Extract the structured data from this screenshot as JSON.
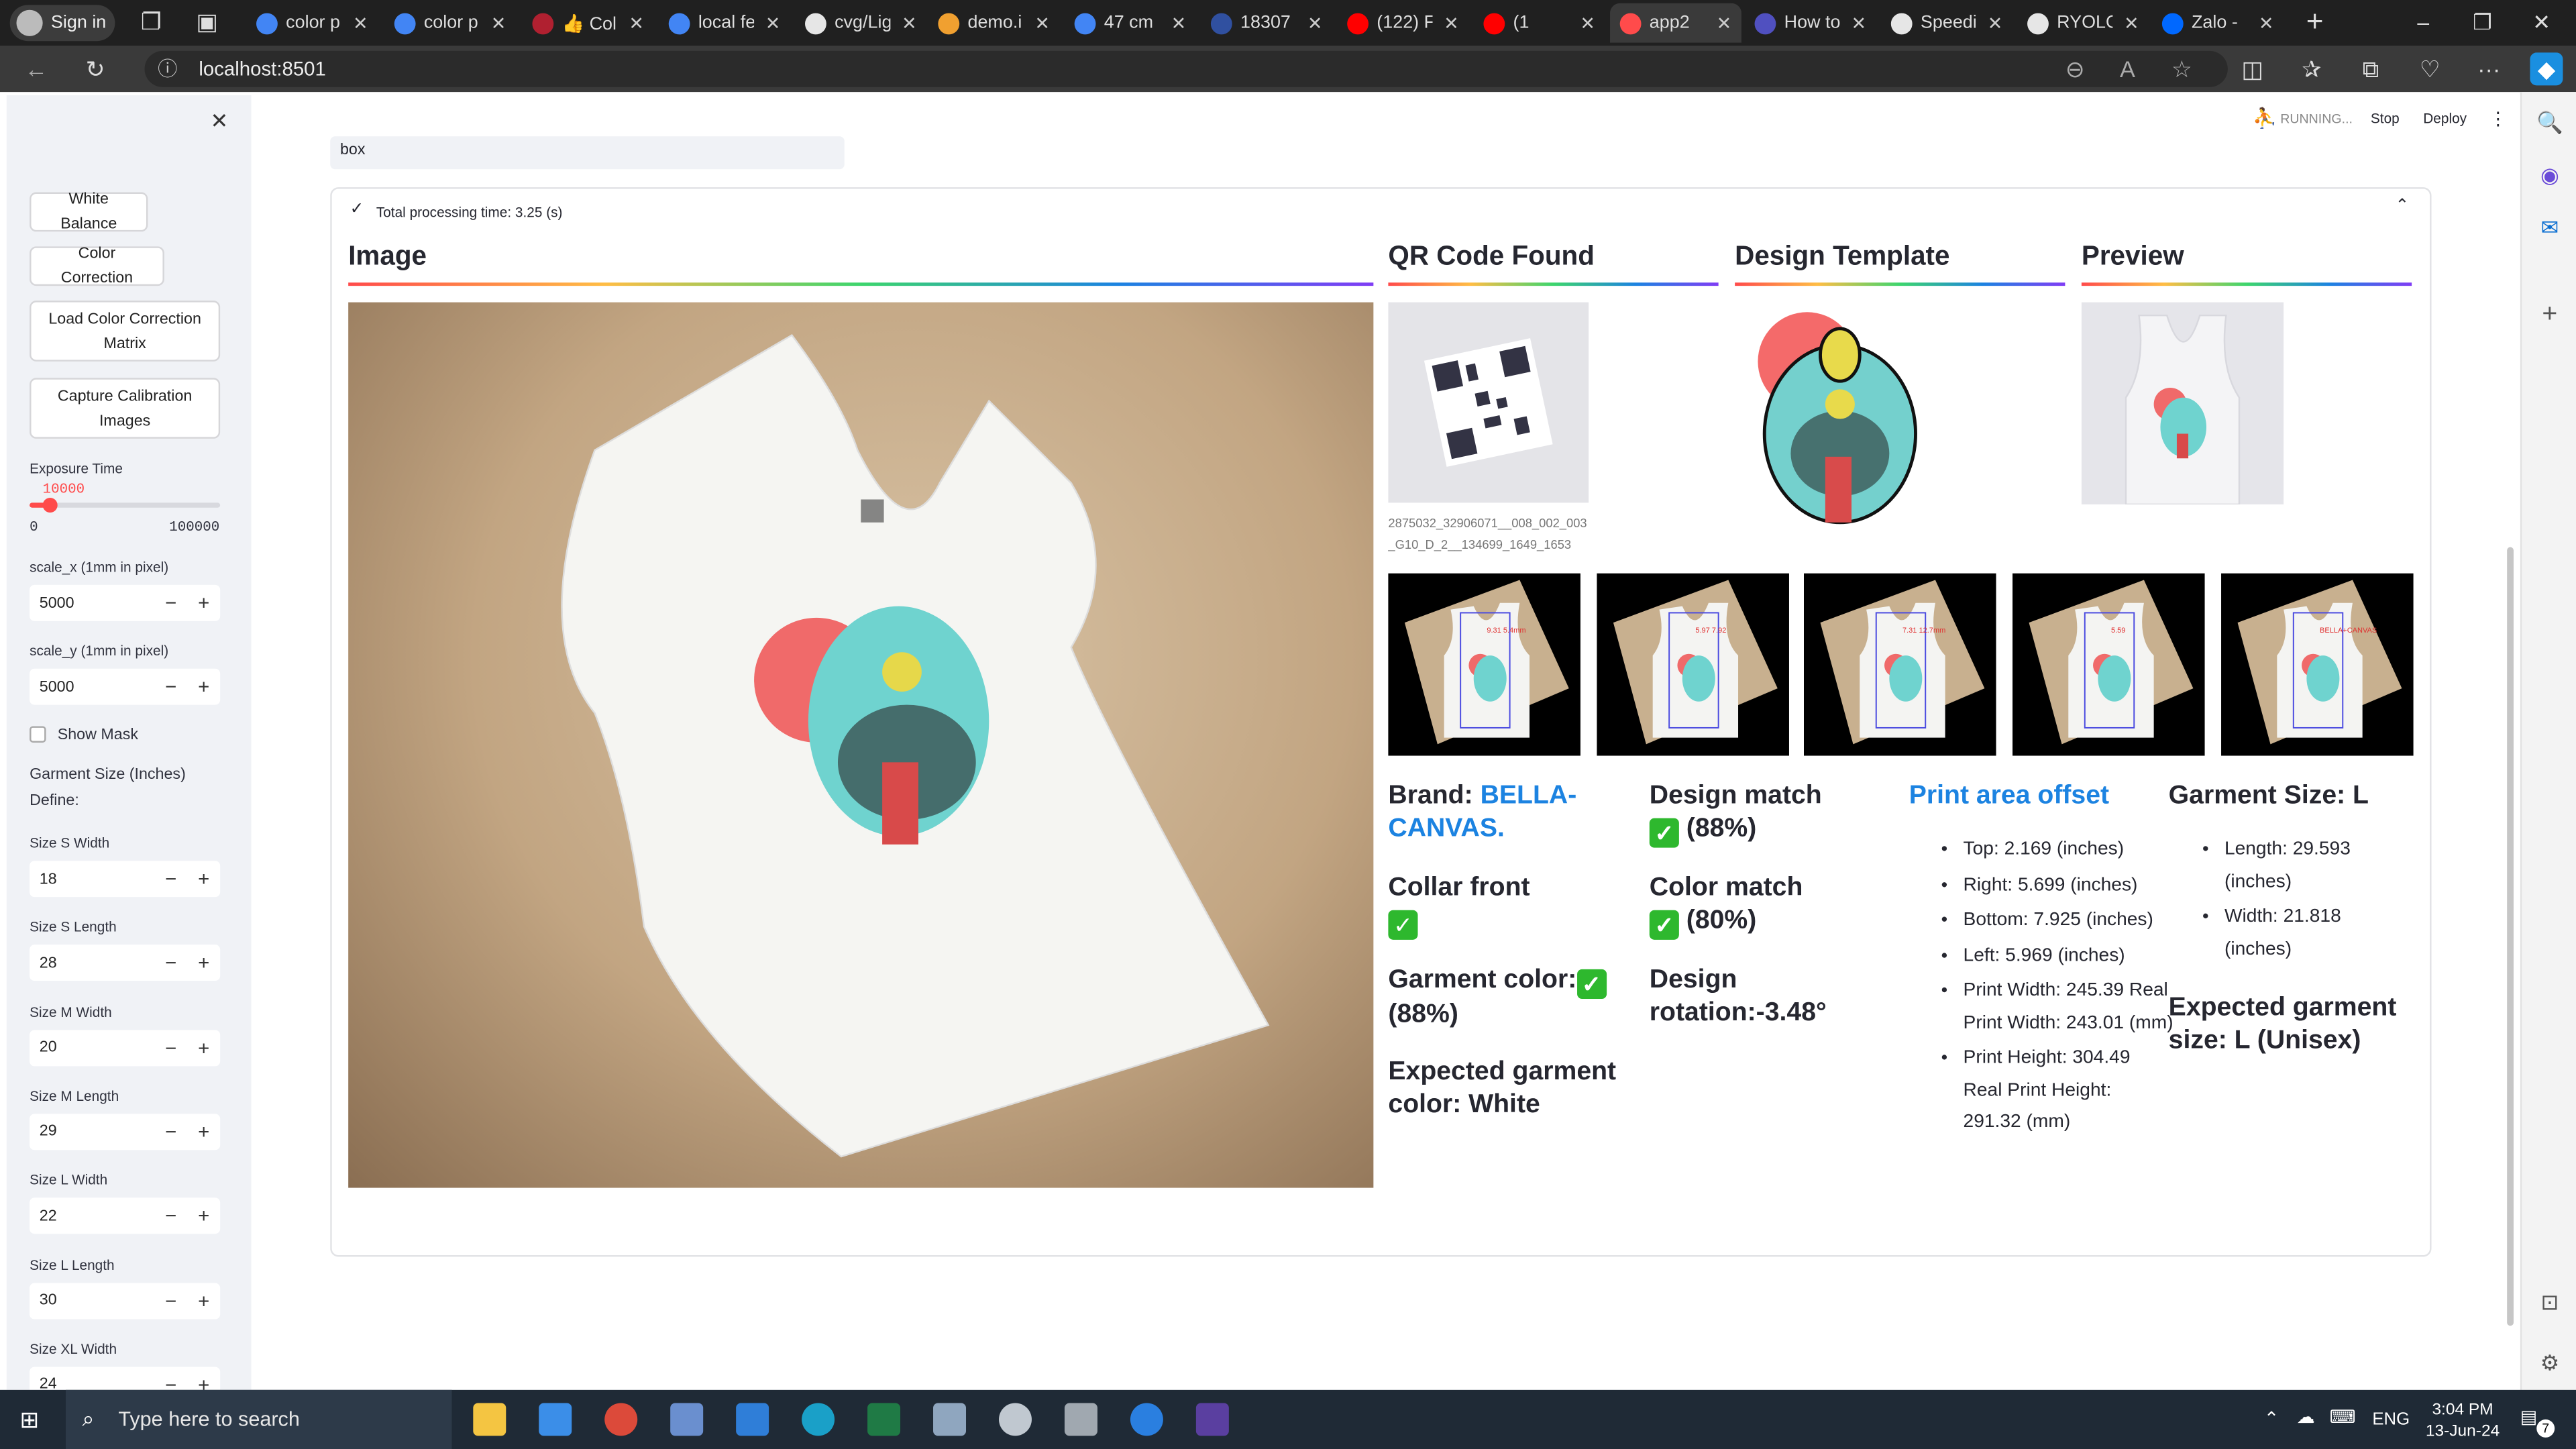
{
  "browser": {
    "sign_in_label": "Sign in",
    "tabs": [
      {
        "title": "color p",
        "icon": "google-icon",
        "color": "#4285f4"
      },
      {
        "title": "color p",
        "icon": "google-icon",
        "color": "#4285f4"
      },
      {
        "title": "👍 Col",
        "icon": "app-icon",
        "color": "#b02030"
      },
      {
        "title": "local fe",
        "icon": "google-icon",
        "color": "#4285f4"
      },
      {
        "title": "cvg/Lig",
        "icon": "github-icon",
        "color": "#e6e6e6"
      },
      {
        "title": "demo.i",
        "icon": "app-icon",
        "color": "#f0a030"
      },
      {
        "title": "47 cm",
        "icon": "google-icon",
        "color": "#4285f4"
      },
      {
        "title": "18307",
        "icon": "app-icon",
        "color": "#3050a0"
      },
      {
        "title": "(122) F",
        "icon": "youtube-icon",
        "color": "#ff0000"
      },
      {
        "title": "(1",
        "icon": "youtube-icon",
        "color": "#ff0000"
      },
      {
        "title": "app2",
        "icon": "streamlit-icon",
        "color": "#ff4b4b"
      },
      {
        "title": "How to",
        "icon": "app-icon",
        "color": "#5050c0"
      },
      {
        "title": "Speedi",
        "icon": "github-icon",
        "color": "#e6e6e6"
      },
      {
        "title": "RYOLO",
        "icon": "github-icon",
        "color": "#e6e6e6"
      },
      {
        "title": "Zalo -",
        "icon": "zalo-icon",
        "color": "#0068ff"
      }
    ],
    "url": "localhost:8501"
  },
  "app_header": {
    "status": "RUNNING...",
    "stop_label": "Stop",
    "deploy_label": "Deploy"
  },
  "sidebar": {
    "buttons": {
      "white_balance": "White Balance",
      "color_correction": "Color Correction",
      "load_matrix": "Load Color Correction Matrix",
      "capture_calibration": "Capture Calibration Images"
    },
    "exposure": {
      "label": "Exposure Time",
      "value": "10000",
      "min": "0",
      "max": "100000",
      "fraction": 0.1
    },
    "scale_x": {
      "label": "scale_x (1mm in pixel)",
      "value": "5000"
    },
    "scale_y": {
      "label": "scale_y (1mm in pixel)",
      "value": "5000"
    },
    "show_mask": "Show Mask",
    "garment_size_title": "Garment Size (Inches)",
    "define_label": "Define:",
    "sizes": [
      {
        "label": "Size S Width",
        "value": "18"
      },
      {
        "label": "Size S Length",
        "value": "28"
      },
      {
        "label": "Size M Width",
        "value": "20"
      },
      {
        "label": "Size M Length",
        "value": "29"
      },
      {
        "label": "Size L Width",
        "value": "22"
      },
      {
        "label": "Size L Length",
        "value": "30"
      },
      {
        "label": "Size XL Width",
        "value": "24"
      }
    ]
  },
  "main": {
    "top_input_value": "box",
    "processing_time": "Total processing time: 3.25 (s)",
    "image_title": "Image",
    "qr_title": "QR Code Found",
    "qr_caption": "2875032_32906071__008_002_003_G10_D_2__134699_1649_1653",
    "design_title": "Design Template",
    "preview_title": "Preview",
    "brand_label": "Brand:",
    "brand_value": "BELLA-CANVAS.",
    "collar_front": "Collar front",
    "garment_color": "Garment color:",
    "garment_color_pct": "(88%)",
    "expected_color": "Expected garment color: White",
    "design_match": "Design match",
    "design_match_pct": "(88%)",
    "color_match": "Color match",
    "color_match_pct": "(80%)",
    "design_rotation": "Design rotation:-3.48°",
    "offset_title": "Print area offset",
    "offset_items": [
      "Top: 2.169 (inches)",
      "Right: 5.699 (inches)",
      "Bottom: 7.925 (inches)",
      "Left: 5.969 (inches)",
      "Print Width: 245.39 Real Print Width: 243.01 (mm)",
      "Print Height: 304.49 Real Print Height: 291.32 (mm)"
    ],
    "garment_size_title": "Garment Size: L",
    "garment_size_items": [
      "Length: 29.593 (inches)",
      "Width: 21.818 (inches)"
    ],
    "expected_size": "Expected garment size: L (Unisex)",
    "thumb_labels": [
      "9.31 5.4mm",
      "5.97 7.92",
      "7.31 12.7mm",
      "5.59",
      "BELLA+CANVAS"
    ]
  },
  "taskbar": {
    "search_placeholder": "Type here to search",
    "lang": "ENG",
    "time": "3:04 PM",
    "date": "13-Jun-24",
    "notif_count": "7"
  }
}
